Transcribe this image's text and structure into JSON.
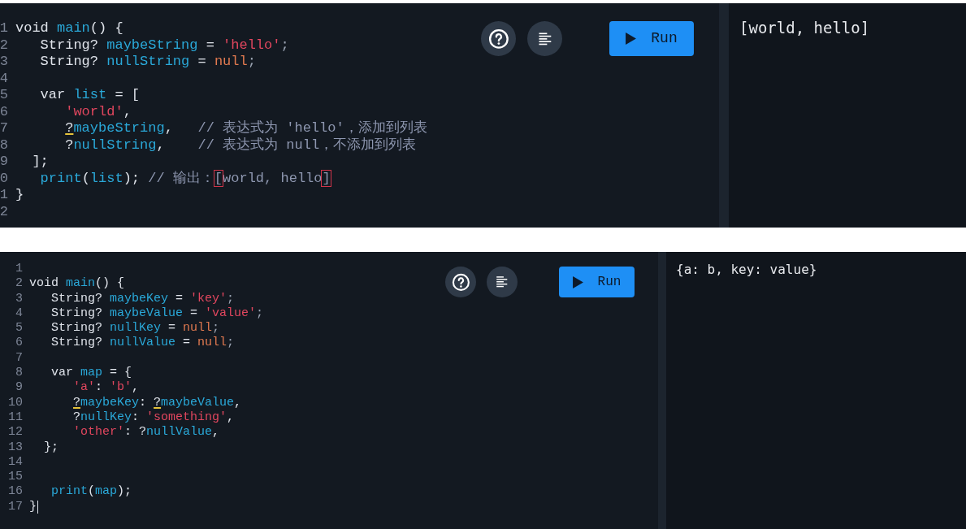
{
  "panels": [
    {
      "editor": {
        "lines": [
          {
            "number": "1",
            "tokens": [
              {
                "kind": "plain",
                "text": "void "
              },
              {
                "kind": "ident",
                "text": "main"
              },
              {
                "kind": "plain",
                "text": "() {"
              }
            ]
          },
          {
            "number": "2",
            "tokens": [
              {
                "kind": "plain",
                "text": "   String? "
              },
              {
                "kind": "ident",
                "text": "maybeString"
              },
              {
                "kind": "plain",
                "text": " = "
              },
              {
                "kind": "string",
                "text": "'hello'"
              },
              {
                "kind": "punct",
                "text": ";"
              }
            ]
          },
          {
            "number": "3",
            "tokens": [
              {
                "kind": "plain",
                "text": "   String? "
              },
              {
                "kind": "ident",
                "text": "nullString"
              },
              {
                "kind": "plain",
                "text": " = "
              },
              {
                "kind": "null",
                "text": "null"
              },
              {
                "kind": "punct",
                "text": ";"
              }
            ]
          },
          {
            "number": "4"
          },
          {
            "number": "5",
            "tokens": [
              {
                "kind": "plain",
                "text": "   var "
              },
              {
                "kind": "ident",
                "text": "list"
              },
              {
                "kind": "plain",
                "text": " = ["
              }
            ]
          },
          {
            "number": "6",
            "tokens": [
              {
                "kind": "string",
                "text": "      'world'"
              },
              {
                "kind": "plain",
                "text": ","
              }
            ]
          },
          {
            "number": "7",
            "tokens": [
              {
                "kind": "warn",
                "text": "      ?"
              },
              {
                "kind": "ident",
                "text": "maybeString"
              },
              {
                "kind": "plain",
                "text": ",   "
              },
              {
                "kind": "comment",
                "text": "// 表达式为 'hello'，添加到列表"
              }
            ]
          },
          {
            "number": "8",
            "tokens": [
              {
                "kind": "plain",
                "text": "      ?"
              },
              {
                "kind": "ident",
                "text": "nullString"
              },
              {
                "kind": "plain",
                "text": ",    "
              },
              {
                "kind": "comment",
                "text": "// 表达式为 null，不添加到列表"
              }
            ]
          },
          {
            "number": "9",
            "tokens": [
              {
                "kind": "plain",
                "text": "  ];"
              }
            ]
          },
          {
            "number": "0",
            "tokens": [
              {
                "kind": "ident",
                "text": "   print"
              },
              {
                "kind": "plain",
                "text": "("
              },
              {
                "kind": "ident",
                "text": "list"
              },
              {
                "kind": "plain",
                "text": "); "
              },
              {
                "kind": "comment",
                "text": "// 输出："
              },
              {
                "kind": "match",
                "text": "["
              },
              {
                "kind": "comment",
                "text": "world, hello"
              },
              {
                "kind": "match",
                "text": "]"
              }
            ]
          },
          {
            "number": "1",
            "tokens": [
              {
                "kind": "plain",
                "text": "}"
              }
            ]
          },
          {
            "number": "2"
          }
        ]
      },
      "run_button": {
        "label": "Run"
      },
      "output": "[world, hello]"
    },
    {
      "editor": {
        "lines": [
          {
            "number": "1"
          },
          {
            "number": "2",
            "tokens": [
              {
                "kind": "plain",
                "text": "void "
              },
              {
                "kind": "ident",
                "text": "main"
              },
              {
                "kind": "plain",
                "text": "() {"
              }
            ]
          },
          {
            "number": "3",
            "tokens": [
              {
                "kind": "plain",
                "text": "   String? "
              },
              {
                "kind": "ident",
                "text": "maybeKey"
              },
              {
                "kind": "plain",
                "text": " = "
              },
              {
                "kind": "string",
                "text": "'key'"
              },
              {
                "kind": "punct",
                "text": ";"
              }
            ]
          },
          {
            "number": "4",
            "tokens": [
              {
                "kind": "plain",
                "text": "   String? "
              },
              {
                "kind": "ident",
                "text": "maybeValue"
              },
              {
                "kind": "plain",
                "text": " = "
              },
              {
                "kind": "string",
                "text": "'value'"
              },
              {
                "kind": "punct",
                "text": ";"
              }
            ]
          },
          {
            "number": "5",
            "tokens": [
              {
                "kind": "plain",
                "text": "   String? "
              },
              {
                "kind": "ident",
                "text": "nullKey"
              },
              {
                "kind": "plain",
                "text": " = "
              },
              {
                "kind": "null",
                "text": "null"
              },
              {
                "kind": "punct",
                "text": ";"
              }
            ]
          },
          {
            "number": "6",
            "tokens": [
              {
                "kind": "plain",
                "text": "   String? "
              },
              {
                "kind": "ident",
                "text": "nullValue"
              },
              {
                "kind": "plain",
                "text": " = "
              },
              {
                "kind": "null",
                "text": "null"
              },
              {
                "kind": "punct",
                "text": ";"
              }
            ]
          },
          {
            "number": "7"
          },
          {
            "number": "8",
            "tokens": [
              {
                "kind": "plain",
                "text": "   var "
              },
              {
                "kind": "ident",
                "text": "map"
              },
              {
                "kind": "plain",
                "text": " = {"
              }
            ]
          },
          {
            "number": "9",
            "tokens": [
              {
                "kind": "string",
                "text": "      'a'"
              },
              {
                "kind": "plain",
                "text": ": "
              },
              {
                "kind": "string",
                "text": "'b'"
              },
              {
                "kind": "plain",
                "text": ","
              }
            ]
          },
          {
            "number": "10",
            "tokens": [
              {
                "kind": "warn",
                "text": "      ?"
              },
              {
                "kind": "ident",
                "text": "maybeKey"
              },
              {
                "kind": "plain",
                "text": ": "
              },
              {
                "kind": "warn",
                "text": "?"
              },
              {
                "kind": "ident",
                "text": "maybeValue"
              },
              {
                "kind": "plain",
                "text": ","
              }
            ]
          },
          {
            "number": "11",
            "tokens": [
              {
                "kind": "plain",
                "text": "      ?"
              },
              {
                "kind": "ident",
                "text": "nullKey"
              },
              {
                "kind": "plain",
                "text": ": "
              },
              {
                "kind": "string",
                "text": "'something'"
              },
              {
                "kind": "plain",
                "text": ","
              }
            ]
          },
          {
            "number": "12",
            "tokens": [
              {
                "kind": "string",
                "text": "      'other'"
              },
              {
                "kind": "plain",
                "text": ": ?"
              },
              {
                "kind": "ident",
                "text": "nullValue"
              },
              {
                "kind": "plain",
                "text": ","
              }
            ]
          },
          {
            "number": "13",
            "tokens": [
              {
                "kind": "plain",
                "text": "  };"
              }
            ]
          },
          {
            "number": "14"
          },
          {
            "number": "15"
          },
          {
            "number": "16",
            "tokens": [
              {
                "kind": "ident",
                "text": "   print"
              },
              {
                "kind": "plain",
                "text": "("
              },
              {
                "kind": "ident",
                "text": "map"
              },
              {
                "kind": "plain",
                "text": ");"
              }
            ]
          },
          {
            "number": "17",
            "tokens": [
              {
                "kind": "plain",
                "text": "}"
              }
            ],
            "cursor": true
          }
        ]
      },
      "run_button": {
        "label": "Run"
      },
      "output": "{a: b, key: value}"
    }
  ]
}
